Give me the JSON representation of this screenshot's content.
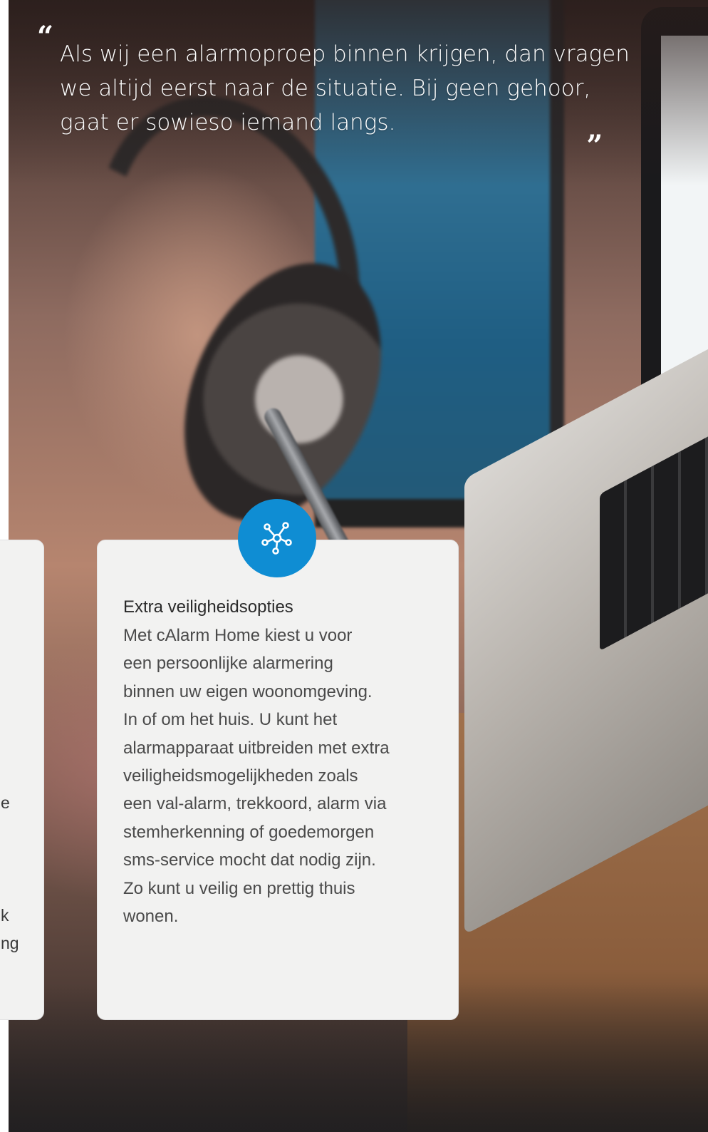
{
  "quote": {
    "open_mark": "“",
    "text": "Als wij een alarmoproep binnen krijgen, dan vragen we altijd eerst naar de situatie. Bij geen gehoor, gaat er sowieso iemand langs.",
    "close_mark": "„"
  },
  "left_card": {
    "fragments": [
      "e",
      "k",
      "ng"
    ]
  },
  "main_card": {
    "icon": "network-hub-icon",
    "title": "Extra veiligheidsopties",
    "body_lines": [
      "Met cAlarm Home kiest u voor",
      "een persoonlijke alarmering",
      "binnen uw eigen woonomgeving.",
      "In of om het huis. U kunt het",
      "alarmapparaat uitbreiden met extra",
      "veiligheidsmogelijkheden zoals",
      "een val-alarm, trekkoord, alarm via",
      "stemherkenning of goedemorgen",
      "sms-service mocht dat nodig zijn.",
      "Zo kunt u veilig en prettig thuis",
      "wonen."
    ]
  },
  "colors": {
    "accent": "#0f8dd3",
    "card_bg": "#f2f2f1",
    "text_dark": "#2a2a2a"
  }
}
